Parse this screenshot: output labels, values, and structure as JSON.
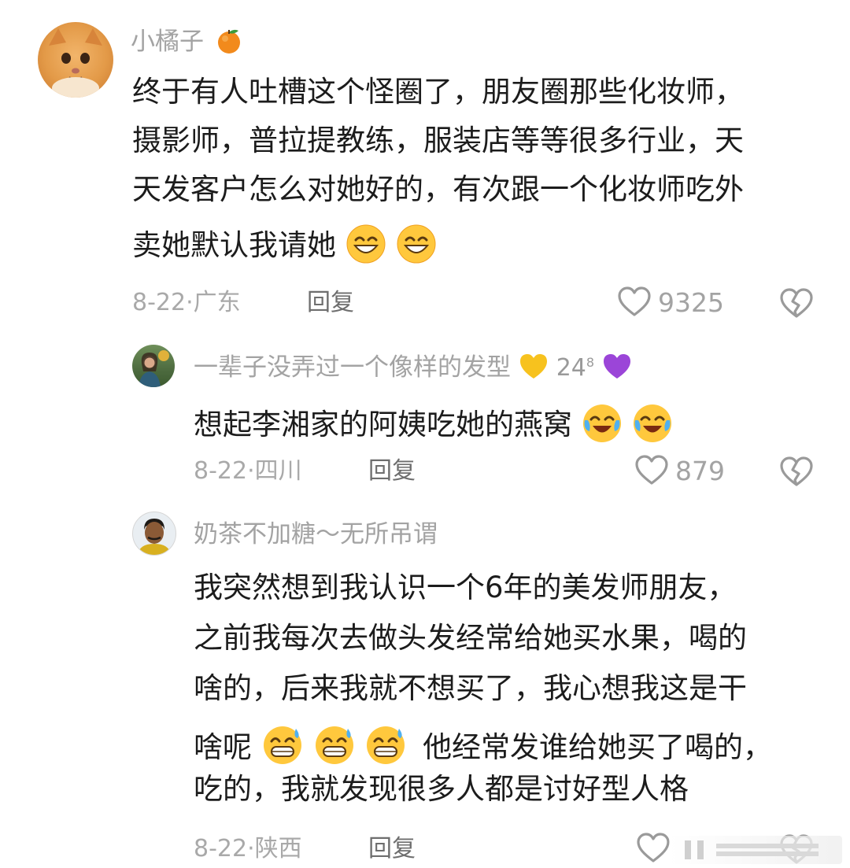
{
  "comments": [
    {
      "name": "小橘子",
      "lines": [
        "终于有人吐槽这个怪圈了，朋友圈那些化妆师，",
        "摄影师，普拉提教练，服装店等等很多行业，天",
        "天发客户怎么对她好的，有次跟一个化妆师吃外",
        "卖她默认我请她"
      ],
      "date_location": "8-22·广东",
      "reply": "回复",
      "likes": "9325"
    },
    {
      "name": "一辈子没弄过一个像样的发型",
      "badge_level": "24",
      "badge_sup": "8",
      "lines": [
        "想起李湘家的阿姨吃她的燕窝"
      ],
      "date_location": "8-22·四川",
      "reply": "回复",
      "likes": "879"
    },
    {
      "name": "奶茶不加糖～无所吊谓",
      "lines": [
        "我突然想到我认识一个6年的美发师朋友，",
        "之前我每次去做头发经常给她买水果，喝的",
        "啥的，后来我就不想买了，我心想我这是干",
        "啥呢",
        "他经常发谁给她买了喝的，",
        "吃的，我就发现很多人都是讨好型人格"
      ],
      "date_location": "8-22·陕西",
      "reply": "回复"
    }
  ],
  "colors": {
    "name": "#a3a3a3",
    "text": "#1c1c1c",
    "meta": "#a9a9a9"
  }
}
